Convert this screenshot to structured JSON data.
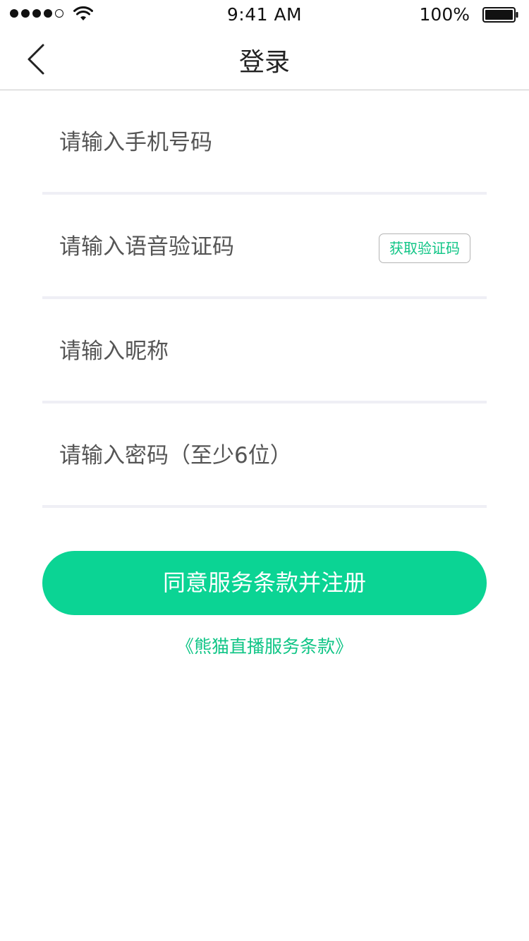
{
  "status_bar": {
    "time": "9:41 AM",
    "battery_percent": "100%",
    "signal_bars": 4,
    "signal_total": 5,
    "icons": [
      "signal-icon",
      "wifi-icon",
      "battery-icon"
    ]
  },
  "nav": {
    "title": "登录",
    "back_icon": "chevron-left-icon"
  },
  "form": {
    "phone_placeholder": "请输入手机号码",
    "phone_value": "",
    "code_placeholder": "请输入语音验证码",
    "code_value": "",
    "get_code_label": "获取验证码",
    "nickname_placeholder": "请输入昵称",
    "nickname_value": "",
    "password_placeholder": "请输入密码（至少6位）",
    "password_value": ""
  },
  "actions": {
    "submit_label": "同意服务条款并注册",
    "terms_link": "《熊猫直播服务条款》"
  },
  "colors": {
    "accent": "#0bd494",
    "accent_text": "#10c586",
    "divider": "#efeff5",
    "nav_border": "#c8c8c8"
  }
}
